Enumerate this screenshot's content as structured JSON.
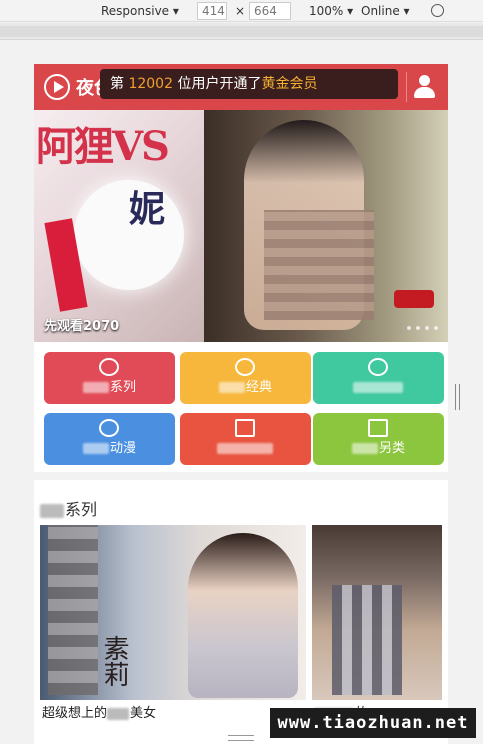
{
  "devtools": {
    "device_label": "Responsive",
    "width_value": "414",
    "times": "×",
    "height_value": "664",
    "zoom_label": "100%",
    "network_label": "Online"
  },
  "header": {
    "logo_text": "夜色影院",
    "ticker_prefix": "第",
    "ticker_number": "12002",
    "ticker_middle": "位用户开通了",
    "ticker_highlight": "黄金会员"
  },
  "banner": {
    "left_title": "阿狸VS",
    "left_sub": "妮",
    "caption": "先观看2070",
    "dots": 4
  },
  "categories": [
    {
      "label": "系列",
      "color": "#e04b57",
      "icon": "satellite-icon"
    },
    {
      "label": "经典",
      "color": "#f6b73c",
      "icon": "bear-icon"
    },
    {
      "label": "",
      "color": "#40c89e",
      "icon": "film-reel-icon"
    },
    {
      "label": "动漫",
      "color": "#4a8fe0",
      "icon": "mask-icon"
    },
    {
      "label": "",
      "color": "#e8543f",
      "icon": "grid-icon"
    },
    {
      "label": "另类",
      "color": "#8cc63e",
      "icon": "film-strip-icon"
    }
  ],
  "section": {
    "title": "系列",
    "cards": [
      {
        "caption_pre": "超级想上的",
        "caption_post": "美女",
        "cover_text": "素莉"
      },
      {
        "caption_pre": "",
        "caption_post": "的"
      }
    ]
  },
  "watermark": "www.tiaozhuan.net"
}
